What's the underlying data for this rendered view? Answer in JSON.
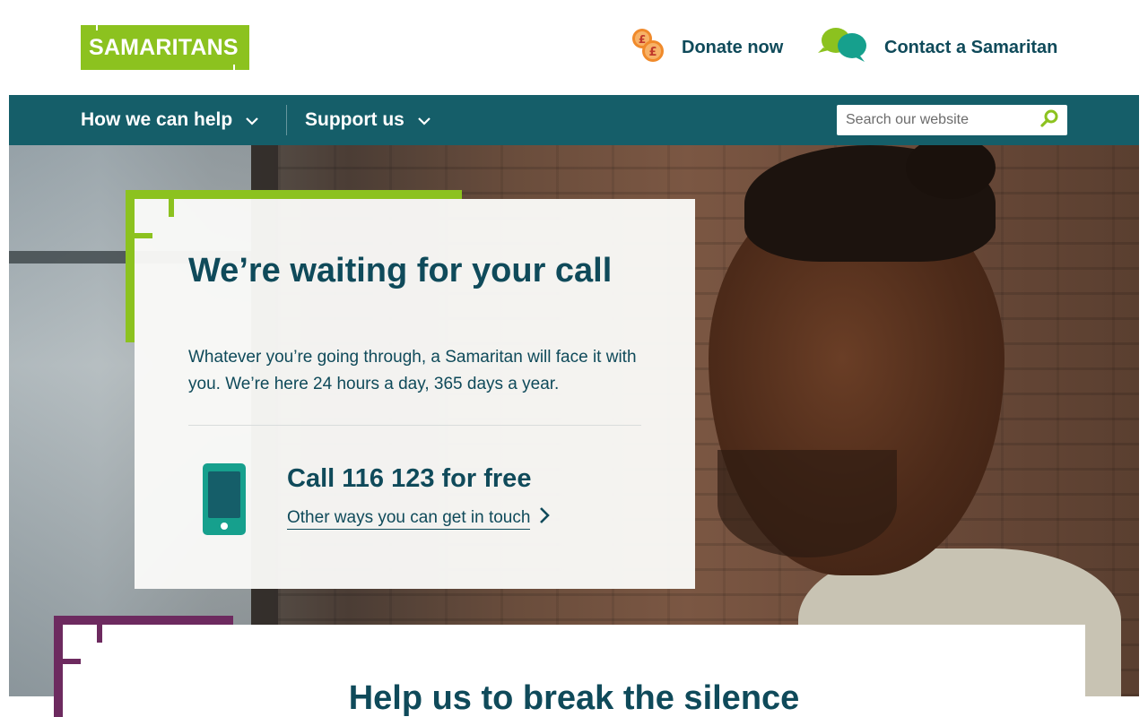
{
  "header": {
    "logo_text": "SAMARITANS",
    "donate_label": "Donate now",
    "donate_icon": "coins-icon",
    "contact_label": "Contact a Samaritan",
    "contact_icon": "speech-bubbles-icon"
  },
  "nav": {
    "items": [
      {
        "label": "How we can help",
        "icon": "chevron-down-icon"
      },
      {
        "label": "Support us",
        "icon": "chevron-down-icon"
      }
    ],
    "search": {
      "placeholder": "Search our website",
      "icon": "search-icon"
    }
  },
  "hero": {
    "title": "We’re waiting for your call",
    "description": "Whatever you’re going through, a Samaritan will face it with you. We’re here 24 hours a day, 365 days a year.",
    "call_title": "Call 116 123 for free",
    "other_ways_label": "Other ways you can get in touch",
    "phone_icon": "mobile-phone-icon",
    "link_icon": "chevron-right-icon"
  },
  "section": {
    "title": "Help us to break the silence"
  },
  "colors": {
    "brand_green": "#8cc21f",
    "nav_teal": "#155e69",
    "text_dark_teal": "#0f4a5a",
    "accent_purple": "#6d2a5f",
    "phone_teal": "#16a08d",
    "coin_orange": "#f08a2b"
  }
}
